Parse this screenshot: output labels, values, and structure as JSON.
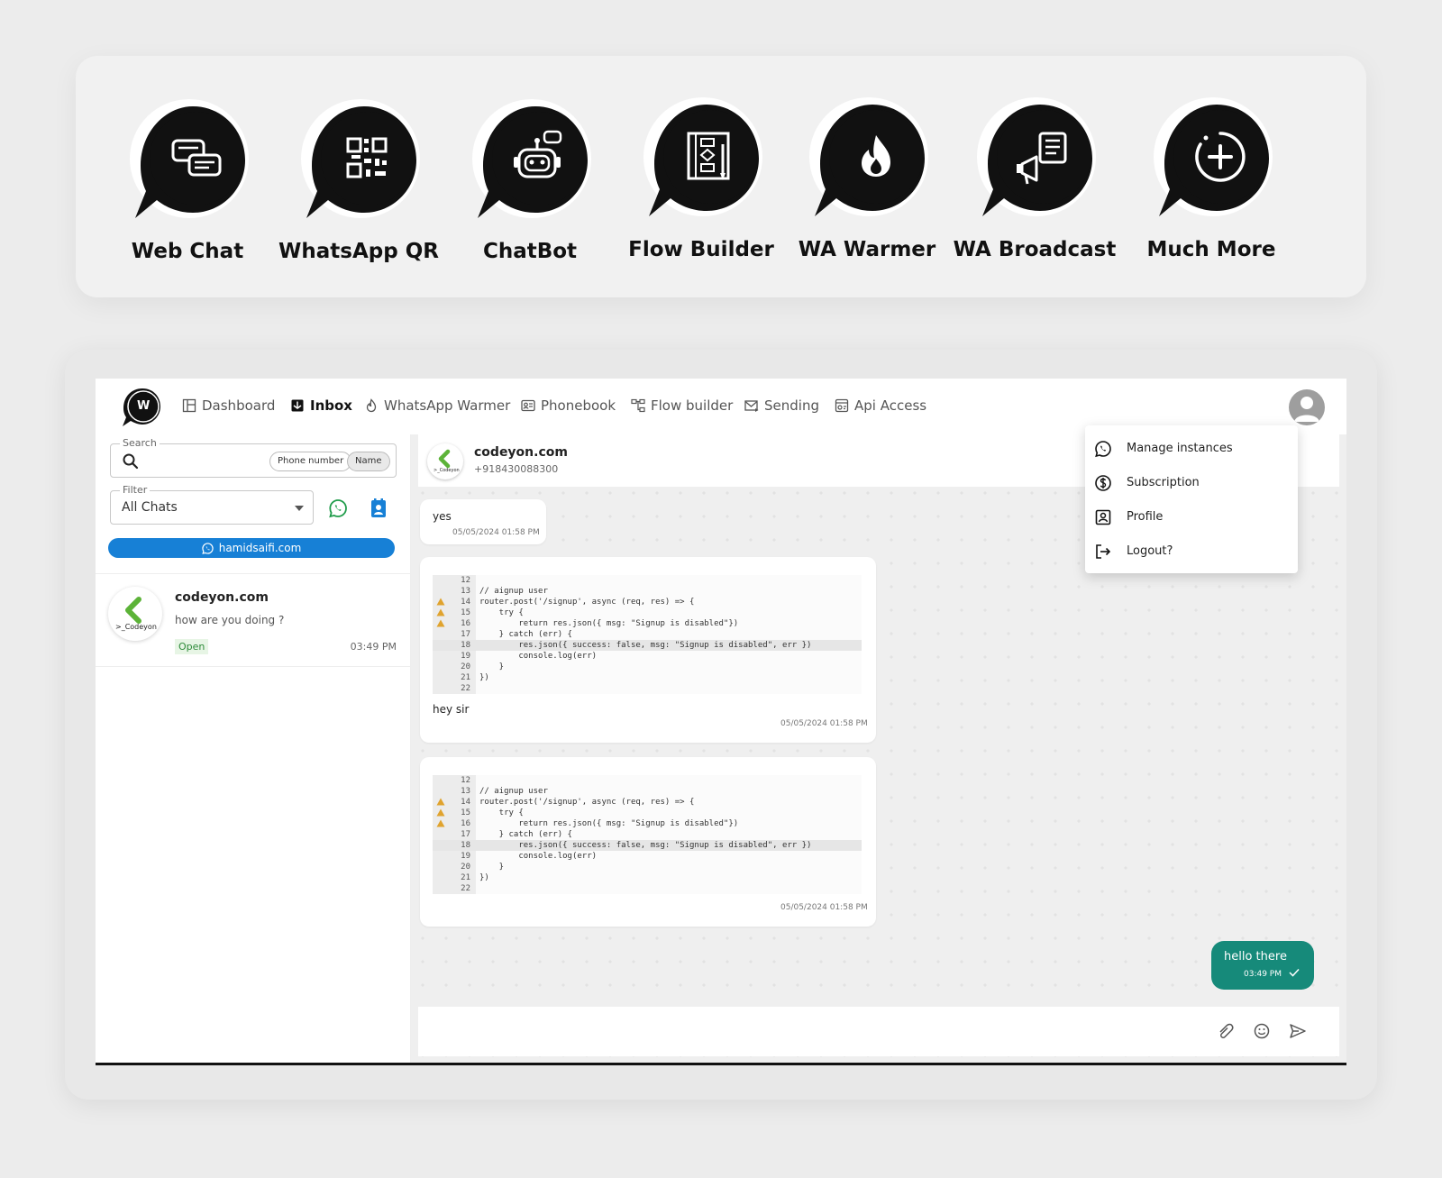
{
  "features": [
    {
      "label": "Web Chat",
      "icon": "chat-bubbles-icon"
    },
    {
      "label": "WhatsApp QR",
      "icon": "qr-code-icon"
    },
    {
      "label": "ChatBot",
      "icon": "robot-icon"
    },
    {
      "label": "Flow Builder",
      "icon": "flowchart-icon"
    },
    {
      "label": "WA Warmer",
      "icon": "flame-icon"
    },
    {
      "label": "WA Broadcast",
      "icon": "megaphone-icon"
    },
    {
      "label": "Much More",
      "icon": "plus-circle-icon"
    }
  ],
  "nav": {
    "logo_text": "W",
    "items": [
      {
        "label": "Dashboard",
        "active": false
      },
      {
        "label": "Inbox",
        "active": true
      },
      {
        "label": "WhatsApp Warmer",
        "active": false
      },
      {
        "label": "Phonebook",
        "active": false
      },
      {
        "label": "Flow builder",
        "active": false
      },
      {
        "label": "Sending",
        "active": false
      },
      {
        "label": "Api Access",
        "active": false
      }
    ]
  },
  "sidebar": {
    "search_label": "Search",
    "chips": [
      "Phone number",
      "Name"
    ],
    "filter_label": "Filter",
    "filter_value": "All Chats",
    "instance": "hamidsaifi.com",
    "chats": [
      {
        "name": "codeyon.com",
        "last_message": "how are you doing ?",
        "status": "Open",
        "time": "03:49 PM",
        "avatar_text": ">_Codeyon"
      }
    ]
  },
  "chat": {
    "contact_name": "codeyon.com",
    "contact_phone": "+918430088300",
    "avatar_text": ">_Codeyon",
    "messages": [
      {
        "text": "yes",
        "time": "05/05/2024 01:58 PM"
      },
      {
        "text": "hey sir",
        "time": "05/05/2024 01:58 PM"
      },
      {
        "text": "",
        "time": "05/05/2024 01:58 PM"
      }
    ],
    "outgoing": {
      "text": "hello there",
      "time": "03:49 PM"
    }
  },
  "code_snippet": {
    "line_numbers": [
      "12",
      "13",
      "14",
      "15",
      "16",
      "17",
      "18",
      "19",
      "20",
      "21",
      "22"
    ],
    "lines": [
      "",
      "// aignup user",
      "router.post('/signup', async (req, res) => {",
      "    try {",
      "        return res.json({ msg: \"Signup is disabled\"})",
      "    } catch (err) {",
      "        res.json({ success: false, msg: \"Signup is disabled\", err })",
      "        console.log(err)",
      "    }",
      "})",
      ""
    ]
  },
  "user_menu": [
    {
      "label": "Manage instances",
      "icon": "whatsapp-icon"
    },
    {
      "label": "Subscription",
      "icon": "dollar-circle-icon"
    },
    {
      "label": "Profile",
      "icon": "profile-card-icon"
    },
    {
      "label": "Logout?",
      "icon": "logout-icon"
    }
  ],
  "colors": {
    "accent_blue": "#1780d6",
    "outgoing_green": "#168a7a",
    "badge_green": "#2e8b3a",
    "whatsapp_green": "#1f9c4a"
  }
}
